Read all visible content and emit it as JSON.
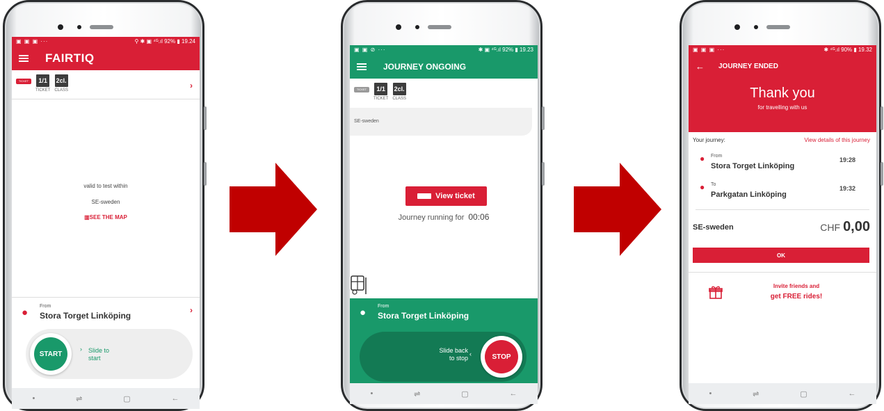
{
  "colors": {
    "brand_red": "#d91f36",
    "journey_green": "#19996a",
    "arrow_red": "#c00000"
  },
  "phone1": {
    "status": {
      "left_icons": "▣ ▣ ▣ ···",
      "right": "⚲ ✱ ▣ ⁴ᴳ.ıl 92% ▮ 19.24"
    },
    "logo": "FAIRTIQ",
    "ticket": {
      "qty": "1/1",
      "qty_label": "TICKET",
      "class": "2cl.",
      "class_label": "CLASS",
      "icon_text": "TICKET"
    },
    "valid_text": "valid to test within",
    "region": "SE-sweden",
    "see_map": "SEE THE MAP",
    "from_label": "From",
    "from_place": "Stora Torget Linköping",
    "start_label": "START",
    "slide_text": "Slide to\nstart"
  },
  "phone2": {
    "status": {
      "left_icons": "▣ ▣ ⊘ ···",
      "right": "✱ ▣ ⁴ᴳ.ıl 92% ▮ 19.23"
    },
    "title": "JOURNEY ONGOING",
    "ticket": {
      "qty": "1/1",
      "qty_label": "TICKET",
      "class": "2cl.",
      "class_label": "CLASS",
      "icon_text": "TICKET"
    },
    "region": "SE-sweden",
    "view_ticket": "View ticket",
    "running_label": "Journey running for",
    "running_time": "00:06",
    "from_label": "From",
    "from_place": "Stora Torget Linköping",
    "slide_back": "Slide back\nto stop",
    "stop_label": "STOP"
  },
  "phone3": {
    "status": {
      "left_icons": "▣ ▣ ▣ ···",
      "right": "✱ ⁴ᴳ.ıl 90% ▮ 19.32"
    },
    "title": "JOURNEY ENDED",
    "thank_you": "Thank you",
    "thank_sub": "for travelling with us",
    "your_journey": "Your journey:",
    "view_details": "View details of this journey",
    "from_label": "From",
    "from_place": "Stora Torget Linköping",
    "from_time": "19:28",
    "to_label": "To",
    "to_place": "Parkgatan Linköping",
    "to_time": "19:32",
    "region": "SE-sweden",
    "currency": "CHF",
    "amount": "0,00",
    "ok": "OK",
    "invite_1": "Invite friends and",
    "invite_2": "get FREE rides!"
  },
  "navbar": {
    "dot": "•",
    "recents": "⇌",
    "home": "▢",
    "back": "←"
  }
}
